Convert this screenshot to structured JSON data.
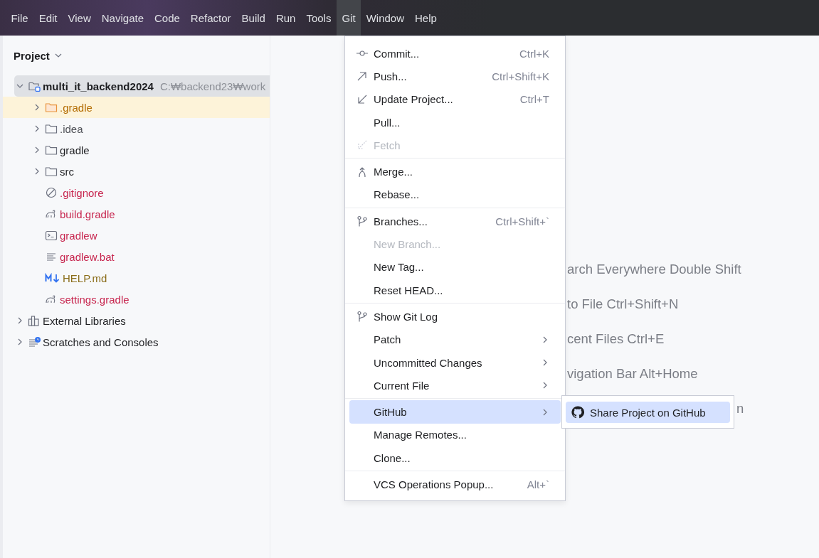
{
  "menu_bar": [
    {
      "label": "File",
      "selected": false
    },
    {
      "label": "Edit",
      "selected": false
    },
    {
      "label": "View",
      "selected": false
    },
    {
      "label": "Navigate",
      "selected": false
    },
    {
      "label": "Code",
      "selected": false
    },
    {
      "label": "Refactor",
      "selected": false
    },
    {
      "label": "Build",
      "selected": false
    },
    {
      "label": "Run",
      "selected": false
    },
    {
      "label": "Tools",
      "selected": false
    },
    {
      "label": "Git",
      "selected": true
    },
    {
      "label": "Window",
      "selected": false
    },
    {
      "label": "Help",
      "selected": false
    }
  ],
  "project_panel": {
    "title": "Project",
    "tree": [
      {
        "kind": "module",
        "name": "multi_it_backend2024",
        "path": "C:₩backend23₩work",
        "selected": true,
        "expanded": true,
        "children": [
          {
            "kind": "folder",
            "name": ".gradle",
            "color": "#b36b00",
            "excluded": true,
            "expanded": false
          },
          {
            "kind": "folder",
            "name": ".idea",
            "color": "#4f5157",
            "excluded": false,
            "expanded": false
          },
          {
            "kind": "folder",
            "name": "gradle",
            "color": "#1e1f22",
            "excluded": false,
            "expanded": false
          },
          {
            "kind": "folder",
            "name": "src",
            "color": "#1e1f22",
            "excluded": false,
            "expanded": false
          },
          {
            "kind": "ignore",
            "name": ".gitignore",
            "color": "#c7254e"
          },
          {
            "kind": "gradle",
            "name": "build.gradle",
            "color": "#c7254e"
          },
          {
            "kind": "shell",
            "name": "gradlew",
            "color": "#c7254e"
          },
          {
            "kind": "text",
            "name": "gradlew.bat",
            "color": "#c7254e"
          },
          {
            "kind": "markdown",
            "name": "HELP.md",
            "color": "#8a6d1a"
          },
          {
            "kind": "gradle",
            "name": "settings.gradle",
            "color": "#c7254e"
          }
        ]
      },
      {
        "kind": "libraries",
        "name": "External Libraries",
        "selected": false,
        "expanded": false
      },
      {
        "kind": "scratches",
        "name": "Scratches and Consoles",
        "selected": false,
        "expanded": false
      }
    ]
  },
  "hints": [
    "arch Everywhere Double Shift",
    "to File Ctrl+Shift+N",
    "cent Files Ctrl+E",
    "vigation Bar Alt+Home",
    "n"
  ],
  "git_menu": {
    "groups": [
      [
        {
          "label": "Commit...",
          "shortcut": "Ctrl+K",
          "kind": "commit",
          "disabled": false
        },
        {
          "label": "Push...",
          "shortcut": "Ctrl+Shift+K",
          "kind": "push",
          "disabled": false
        },
        {
          "label": "Update Project...",
          "shortcut": "Ctrl+T",
          "kind": "update",
          "disabled": false
        },
        {
          "label": "Pull...",
          "disabled": false
        },
        {
          "label": "Fetch",
          "kind": "fetch",
          "disabled": true
        }
      ],
      [
        {
          "label": "Merge...",
          "kind": "merge",
          "disabled": false
        },
        {
          "label": "Rebase...",
          "disabled": false
        }
      ],
      [
        {
          "label": "Branches...",
          "shortcut": "Ctrl+Shift+`",
          "kind": "branch",
          "disabled": false
        },
        {
          "label": "New Branch...",
          "disabled": true
        },
        {
          "label": "New Tag...",
          "disabled": false
        },
        {
          "label": "Reset HEAD...",
          "disabled": false
        }
      ],
      [
        {
          "label": "Show Git Log",
          "kind": "branch",
          "disabled": false
        },
        {
          "label": "Patch",
          "submenu": true,
          "disabled": false
        },
        {
          "label": "Uncommitted Changes",
          "submenu": true,
          "disabled": false
        },
        {
          "label": "Current File",
          "submenu": true,
          "disabled": false
        }
      ],
      [
        {
          "label": "GitHub",
          "submenu": true,
          "selected": true,
          "disabled": false
        },
        {
          "label": "Manage Remotes...",
          "disabled": false
        },
        {
          "label": "Clone...",
          "disabled": false
        }
      ],
      [
        {
          "label": "VCS Operations Popup...",
          "shortcut": "Alt+`",
          "disabled": false
        }
      ]
    ]
  },
  "github_submenu": [
    {
      "label": "Share Project on GitHub",
      "selected": true
    }
  ]
}
